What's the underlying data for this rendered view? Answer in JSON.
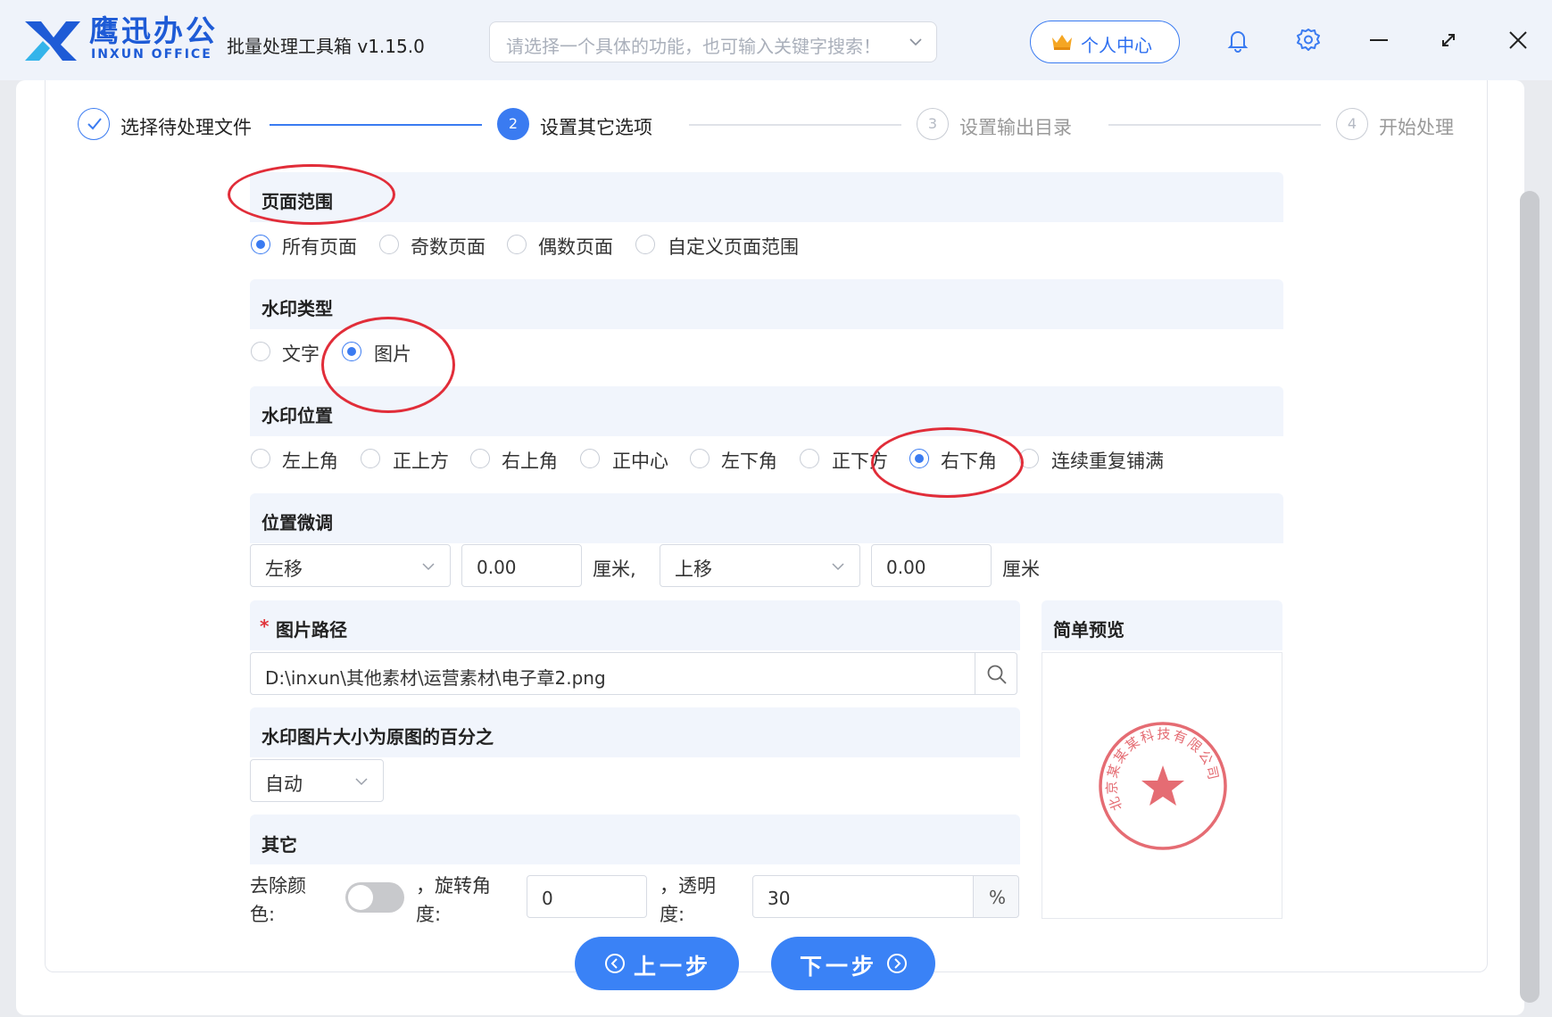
{
  "app": {
    "logo_cn": "鹰迅办公",
    "logo_en": "INXUN OFFICE",
    "title": "批量处理工具箱 v1.15.0",
    "search_placeholder": "请选择一个具体的功能，也可输入关键字搜索！",
    "user_center": "个人中心",
    "icons": [
      "bell-icon",
      "gear-icon",
      "minimize-icon",
      "maximize-icon",
      "close-icon"
    ]
  },
  "steps": [
    {
      "number": "",
      "label": "选择待处理文件",
      "state": "done"
    },
    {
      "number": "2",
      "label": "设置其它选项",
      "state": "active"
    },
    {
      "number": "3",
      "label": "设置输出目录",
      "state": "pending"
    },
    {
      "number": "4",
      "label": "开始处理",
      "state": "pending"
    }
  ],
  "page_range": {
    "title": "页面范围",
    "options": [
      "所有页面",
      "奇数页面",
      "偶数页面",
      "自定义页面范围"
    ],
    "selected": "所有页面"
  },
  "watermark_type": {
    "title": "水印类型",
    "options": [
      "文字",
      "图片"
    ],
    "selected": "图片"
  },
  "watermark_position": {
    "title": "水印位置",
    "options": [
      "左上角",
      "正上方",
      "右上角",
      "正中心",
      "左下角",
      "正下方",
      "右下角",
      "连续重复铺满"
    ],
    "selected": "右下角"
  },
  "fine_tune": {
    "title": "位置微调",
    "h_direction": "左移",
    "h_value": "0.00",
    "h_unit": "厘米,",
    "v_direction": "上移",
    "v_value": "0.00",
    "v_unit": "厘米"
  },
  "image_path": {
    "required_mark": "*",
    "title": "图片路径",
    "value": "D:\\inxun\\其他素材\\运营素材\\电子章2.png"
  },
  "image_size": {
    "title": "水印图片大小为原图的百分之",
    "value": "自动"
  },
  "other": {
    "title": "其它",
    "remove_color_label_1": "去除颜",
    "remove_color_label_2": "色:",
    "remove_color_on": false,
    "rotate_label_1": "，旋转角",
    "rotate_label_2": "度:",
    "rotate_value": "0",
    "opacity_label_1": "，透明",
    "opacity_label_2": "度:",
    "opacity_value": "30",
    "opacity_unit": "%"
  },
  "preview": {
    "title": "简单预览",
    "stamp_text": "北京某某某科技有限公司",
    "stamp_color": "#e0525a"
  },
  "buttons": {
    "prev": "上一步",
    "next": "下一步"
  },
  "colors": {
    "accent": "#3a7bf1",
    "highlight": "#e12d39"
  }
}
